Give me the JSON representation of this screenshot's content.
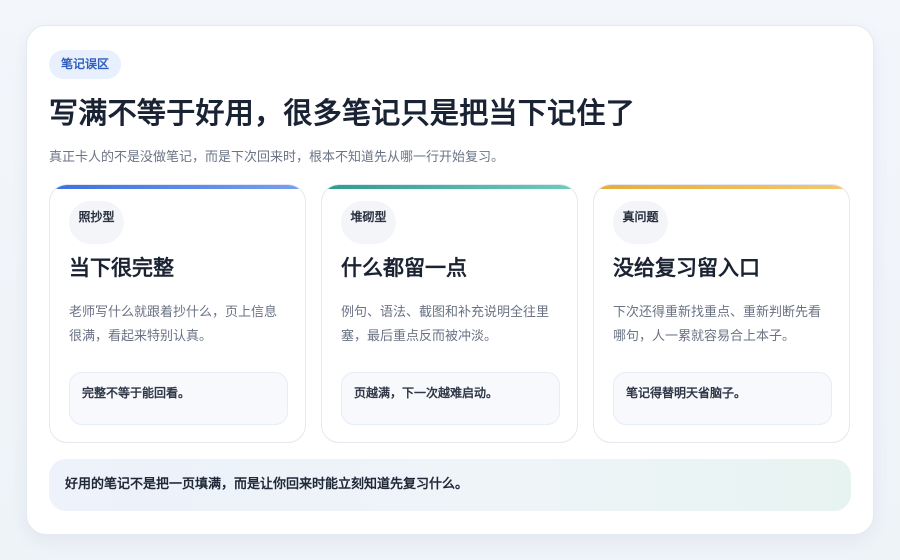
{
  "badge": "笔记误区",
  "title": "写满不等于好用，很多笔记只是把当下记住了",
  "subtitle": "真正卡人的不是没做笔记，而是下次回来时，根本不知道先从哪一行开始复习。",
  "cards": [
    {
      "tag": "照抄型",
      "heading": "当下很完整",
      "description": "老师写什么就跟着抄什么，页上信息很满，看起来特别认真。",
      "note": "完整不等于能回看。"
    },
    {
      "tag": "堆砌型",
      "heading": "什么都留一点",
      "description": "例句、语法、截图和补充说明全往里塞，最后重点反而被冲淡。",
      "note": "页越满，下一次越难启动。"
    },
    {
      "tag": "真问题",
      "heading": "没给复习留入口",
      "description": "下次还得重新找重点、重新判断先看哪句，人一累就容易合上本子。",
      "note": "笔记得替明天省脑子。"
    }
  ],
  "summary": "好用的笔记不是把一页填满，而是让你回来时能立刻知道先复习什么。"
}
